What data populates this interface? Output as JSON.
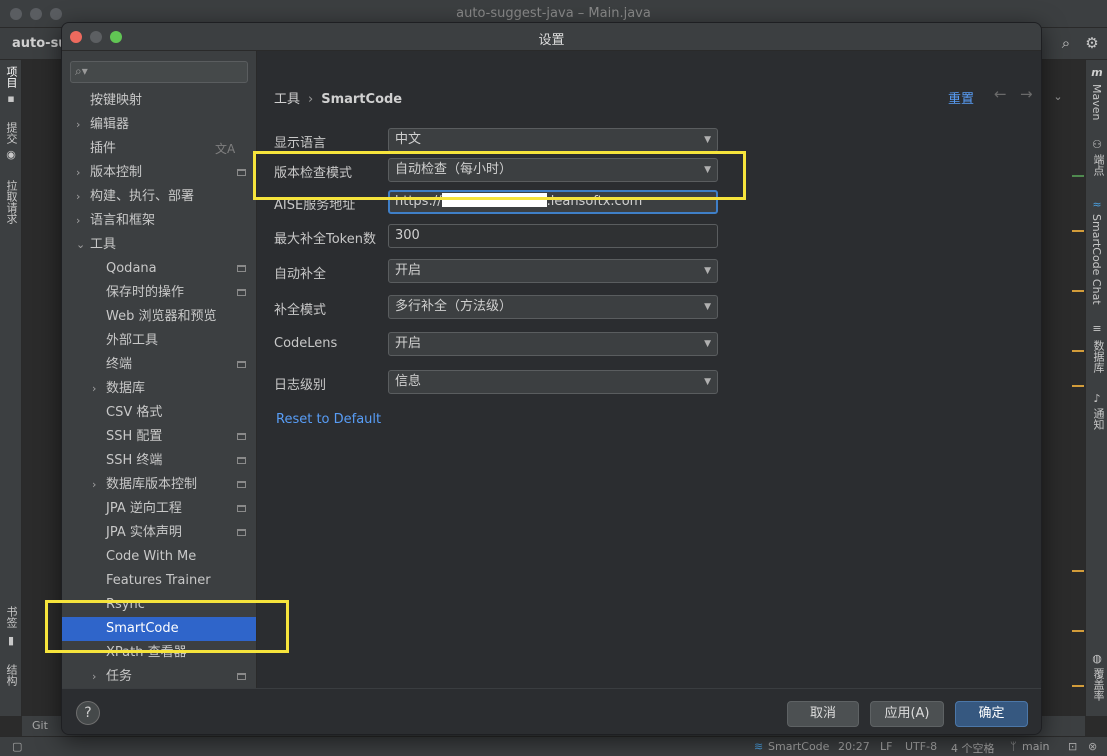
{
  "ide": {
    "window_title": "auto-suggest-java – Main.java",
    "project_name": "auto-su",
    "left_tabs": [
      "项目",
      "提交",
      "拉取请求",
      "书签",
      "结构"
    ],
    "right_tabs": [
      "Maven",
      "端点",
      "SmartCode Chat",
      "数据库",
      "通知",
      "覆盖率"
    ],
    "bottom_left": "Git",
    "status": {
      "plugin": "SmartCode",
      "time": "20:27",
      "line_ending": "LF",
      "encoding": "UTF-8",
      "indent": "4 个空格",
      "branch": "main"
    },
    "icons": [
      "search-icon",
      "gear-icon",
      "m-icon"
    ]
  },
  "dialog": {
    "title": "设置",
    "search": {
      "placeholder": "",
      "value": ""
    },
    "tree": [
      {
        "label": "按键映射",
        "level": 0,
        "arrow": ""
      },
      {
        "label": "编辑器",
        "level": 0,
        "arrow": "›"
      },
      {
        "label": "插件",
        "level": 0,
        "arrow": "",
        "badge": "translate"
      },
      {
        "label": "版本控制",
        "level": 0,
        "arrow": "›",
        "side": true
      },
      {
        "label": "构建、执行、部署",
        "level": 0,
        "arrow": "›"
      },
      {
        "label": "语言和框架",
        "level": 0,
        "arrow": "›"
      },
      {
        "label": "工具",
        "level": 0,
        "arrow": "⌄"
      },
      {
        "label": "Qodana",
        "level": 1,
        "arrow": "",
        "side": true
      },
      {
        "label": "保存时的操作",
        "level": 1,
        "arrow": "",
        "side": true
      },
      {
        "label": "Web 浏览器和预览",
        "level": 1,
        "arrow": ""
      },
      {
        "label": "外部工具",
        "level": 1,
        "arrow": ""
      },
      {
        "label": "终端",
        "level": 1,
        "arrow": "",
        "side": true
      },
      {
        "label": "数据库",
        "level": 1,
        "arrow": "›"
      },
      {
        "label": "CSV 格式",
        "level": 1,
        "arrow": ""
      },
      {
        "label": "SSH 配置",
        "level": 1,
        "arrow": "",
        "side": true
      },
      {
        "label": "SSH 终端",
        "level": 1,
        "arrow": "",
        "side": true
      },
      {
        "label": "数据库版本控制",
        "level": 1,
        "arrow": "›",
        "side": true
      },
      {
        "label": "JPA 逆向工程",
        "level": 1,
        "arrow": "",
        "side": true
      },
      {
        "label": "JPA 实体声明",
        "level": 1,
        "arrow": "",
        "side": true
      },
      {
        "label": "Code With Me",
        "level": 1,
        "arrow": ""
      },
      {
        "label": "Features Trainer",
        "level": 1,
        "arrow": ""
      },
      {
        "label": "Rsync",
        "level": 1,
        "arrow": ""
      },
      {
        "label": "SmartCode",
        "level": 1,
        "arrow": "",
        "selected": true
      },
      {
        "label": "XPath 查看器",
        "level": 1,
        "arrow": ""
      },
      {
        "label": "任务",
        "level": 1,
        "arrow": "›",
        "side": true
      }
    ],
    "breadcrumb": {
      "parent": "工具",
      "current": "SmartCode"
    },
    "reset_link": "重置",
    "form": [
      {
        "label": "显示语言",
        "value": "中文",
        "type": "select"
      },
      {
        "label": "版本检查模式",
        "value": "自动检查（每小时）",
        "type": "select"
      },
      {
        "label": "AISE服务地址",
        "value_prefix": "https://",
        "value_suffix": ".leansoftx.com",
        "type": "input"
      },
      {
        "label": "最大补全Token数",
        "value": "300",
        "type": "input"
      },
      {
        "label": "自动补全",
        "value": "开启",
        "type": "select"
      },
      {
        "label": "补全模式",
        "value": "多行补全（方法级）",
        "type": "select"
      },
      {
        "label": "CodeLens",
        "value": "开启",
        "type": "select"
      },
      {
        "label": "日志级别",
        "value": "信息",
        "type": "select"
      }
    ],
    "reset_default": "Reset to Default",
    "help": "?",
    "buttons": {
      "cancel": "取消",
      "apply": "应用(A)",
      "ok": "确定"
    },
    "colors": {
      "accent": "#2f65ca",
      "highlight": "#f6e43c",
      "link": "#589df6"
    }
  }
}
